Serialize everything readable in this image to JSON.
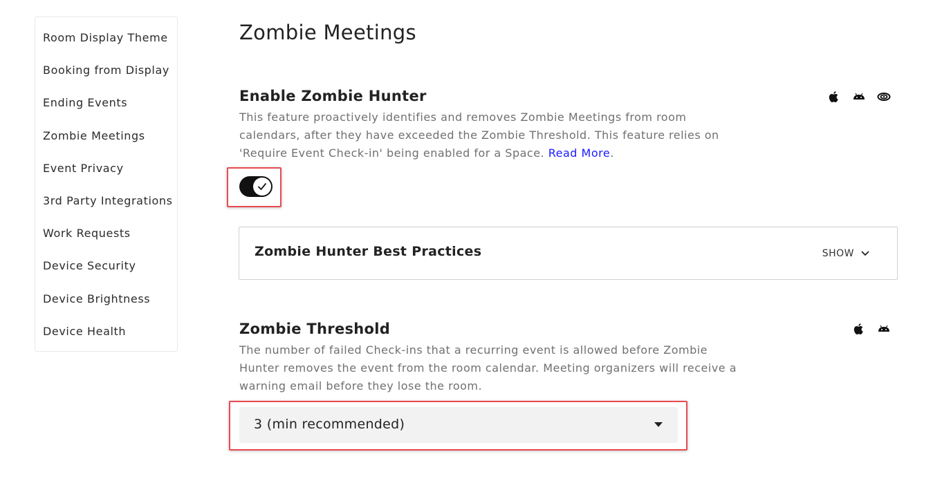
{
  "sidebar": {
    "items": [
      {
        "label": "Room Display Theme"
      },
      {
        "label": "Booking from Display"
      },
      {
        "label": "Ending Events"
      },
      {
        "label": "Zombie Meetings"
      },
      {
        "label": "Event Privacy"
      },
      {
        "label": "3rd Party Integrations"
      },
      {
        "label": "Work Requests"
      },
      {
        "label": "Device Security"
      },
      {
        "label": "Device Brightness"
      },
      {
        "label": "Device Health"
      }
    ]
  },
  "page": {
    "title": "Zombie Meetings"
  },
  "enable_zombie_hunter": {
    "title": "Enable Zombie Hunter",
    "description": "This feature proactively identifies and removes Zombie Meetings from room calendars, after they have exceeded the Zombie Threshold. This feature relies on 'Require Event Check-in' being enabled for a Space. ",
    "read_more": "Read More",
    "trailing_period": ".",
    "toggle_on": true,
    "platform_icons": [
      "apple-icon",
      "android-icon",
      "galaxy-icon"
    ]
  },
  "best_practices": {
    "title": "Zombie Hunter Best Practices",
    "toggle_label": "SHOW"
  },
  "zombie_threshold": {
    "title": "Zombie Threshold",
    "description": "The number of failed Check-ins that a recurring event is allowed before Zombie Hunter removes the event from the room calendar. Meeting organizers will receive a warning email before they lose the room.",
    "selected_value": "3 (min recommended)",
    "platform_icons": [
      "apple-icon",
      "android-icon"
    ]
  },
  "colors": {
    "accent_link": "#1a1aff",
    "highlight": "#e84a50",
    "toggle_on": "#111111"
  }
}
